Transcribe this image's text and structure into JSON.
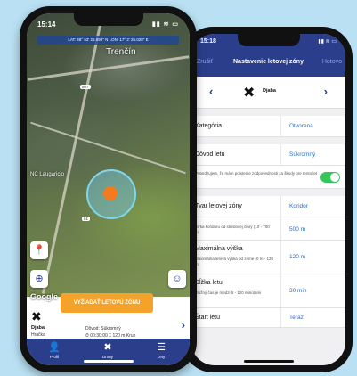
{
  "left_phone": {
    "status": {
      "time": "15:14",
      "icons": "▮▮ ≋ ▭"
    },
    "coords": "LAT: 48° 53' 25.698\" N    LON: 17° 2' 25.028\" E",
    "map": {
      "city": "Trenčín",
      "place": "NC Laugaricio",
      "road_numbers": [
        "507",
        "61"
      ],
      "google": "Google"
    },
    "cta_label": "VYŽIADAŤ LETOVÚ ZÓNU",
    "info": {
      "drone_name": "Djaba",
      "drone_type": "Hračka",
      "reason": "Dôvod: Súkromný",
      "details": "⏱ 00:30:00   ⌶ 120 m   Kruh"
    },
    "tabs": [
      {
        "icon": "👤",
        "label": "Profil"
      },
      {
        "icon": "✖",
        "label": "Drony"
      },
      {
        "icon": "☰",
        "label": "Lety"
      }
    ]
  },
  "right_phone": {
    "status": {
      "time": "15:18",
      "icons": "▮▮ ≋ ▭"
    },
    "nav": {
      "cancel": "Zrušiť",
      "title": "Nastavenie letovej zóny",
      "done": "Hotovo"
    },
    "drone": {
      "name": "Djaba"
    },
    "rows": {
      "category": {
        "label": "Kategória",
        "value": "Otvorená"
      },
      "reason": {
        "label": "Dôvod letu",
        "value": "Súkromný"
      },
      "insurance": {
        "sub": "Potvrdzujem, že mám poistenie zodpovednosti za škody pre tento let",
        "on": true
      },
      "shape": {
        "label": "Tvar letovej zóny",
        "value": "Koridor"
      },
      "width": {
        "sub": "Šírka koridoru od stredovej čiary (10 - 700 m)",
        "value": "500 m"
      },
      "height": {
        "label": "Maximálna výška",
        "sub": "Maximálna letová výška od zeme (0 m - 120 m)",
        "value": "120 m"
      },
      "duration": {
        "label": "Dĺžka letu",
        "sub": "Možný čas je medzi 5 - 120 minútami",
        "value": "30 min"
      },
      "start": {
        "label": "Štart letu",
        "value": "Teraz"
      }
    }
  }
}
